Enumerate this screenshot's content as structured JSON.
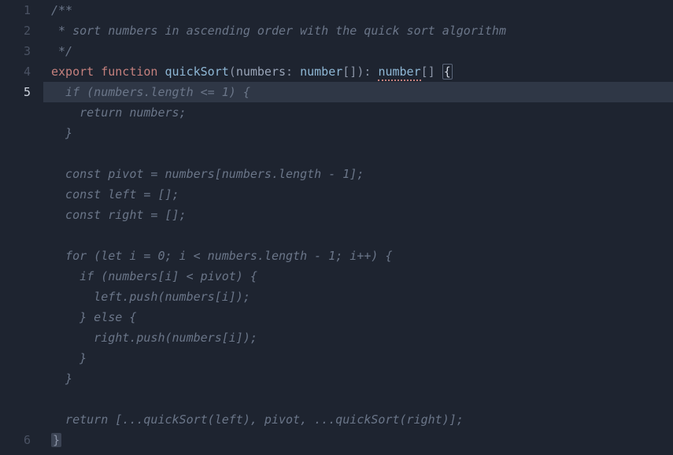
{
  "gutter": {
    "lines": [
      "1",
      "2",
      "3",
      "4",
      "5",
      "6"
    ],
    "activeLine": "5",
    "suggestionSpan": 16
  },
  "code": {
    "l1": "/**",
    "l2": " * sort numbers in ascending order with the quick sort algorithm",
    "l3": " */",
    "l4_export": "export",
    "l4_function": "function",
    "l4_name": "quickSort",
    "l4_paren_open": "(",
    "l4_param": "numbers",
    "l4_colon1": ": ",
    "l4_type1": "number",
    "l4_brackets1": "[]",
    "l4_paren_close": ")",
    "l4_colon2": ": ",
    "l4_type2": "number",
    "l4_brackets2": "[]",
    "l4_space": " ",
    "l4_brace": "{",
    "s1": "  if (numbers.length <= 1) {",
    "s2": "    return numbers;",
    "s3": "  }",
    "s4": "",
    "s5": "  const pivot = numbers[numbers.length - 1];",
    "s6": "  const left = [];",
    "s7": "  const right = [];",
    "s8": "",
    "s9": "  for (let i = 0; i < numbers.length - 1; i++) {",
    "s10": "    if (numbers[i] < pivot) {",
    "s11": "      left.push(numbers[i]);",
    "s12": "    } else {",
    "s13": "      right.push(numbers[i]);",
    "s14": "    }",
    "s15": "  }",
    "s16": "",
    "s17": "  return [...quickSort(left), pivot, ...quickSort(right)];",
    "l6": "}"
  }
}
